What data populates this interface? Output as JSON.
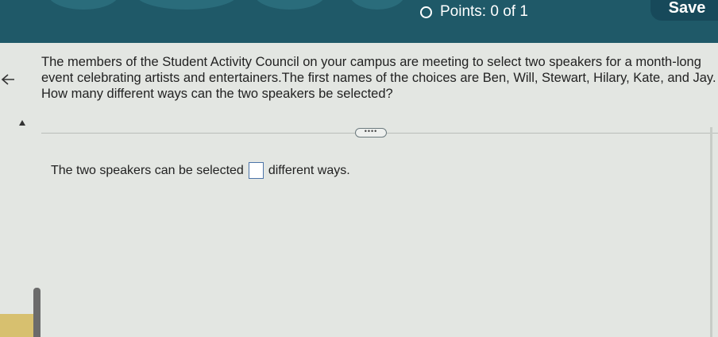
{
  "header": {
    "points_label": "Points: 0 of 1",
    "save_label": "Save"
  },
  "question": {
    "line1": "The members of the Student Activity Council on your campus are meeting to select two speakers for a month-long",
    "line2": "event celebrating artists and entertainers.The first names of the choices are Ben, Will, Stewart, Hilary, Kate, and Jay.",
    "line3": "How many different ways can the two speakers be selected?"
  },
  "more_button": "••••",
  "answer": {
    "prefix": "The two speakers can be selected",
    "value": "",
    "suffix": "different ways."
  }
}
